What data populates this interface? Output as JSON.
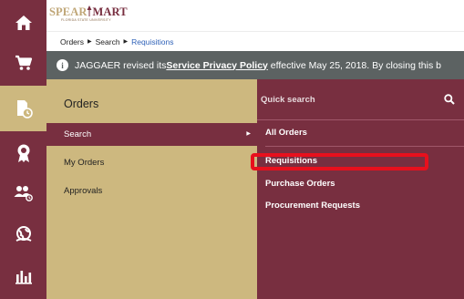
{
  "header": {
    "logo_part1": "SPEAR",
    "logo_part2": "MART",
    "logo_subtitle": "FLORIDA STATE UNIVERSITY"
  },
  "breadcrumb": [
    "Orders",
    "Search",
    "Requisitions"
  ],
  "banner": {
    "text_before": "JAGGAER revised its ",
    "link": "Service Privacy Policy",
    "text_after": " effective May 25, 2018. By closing this b"
  },
  "rail": {
    "icons": [
      "home-icon",
      "cart-icon",
      "document-clock-icon",
      "award-ribbon-icon",
      "people-icon",
      "globe-hand-icon",
      "bar-chart-icon"
    ],
    "active_index": 2
  },
  "orders_menu": {
    "title": "Orders",
    "items": [
      "Search",
      "My Orders",
      "Approvals"
    ],
    "selected": "Search"
  },
  "search_menu": {
    "quick_search_placeholder": "Quick search",
    "items": [
      "All Orders",
      "Requisitions",
      "Purchase Orders",
      "Procurement Requests"
    ],
    "highlighted": "Requisitions"
  },
  "colors": {
    "garnet": "#782f40",
    "gold": "#cdb87f",
    "banner": "#5c6262",
    "link_blue": "#2f62b8",
    "highlight_red": "#e8101d"
  }
}
